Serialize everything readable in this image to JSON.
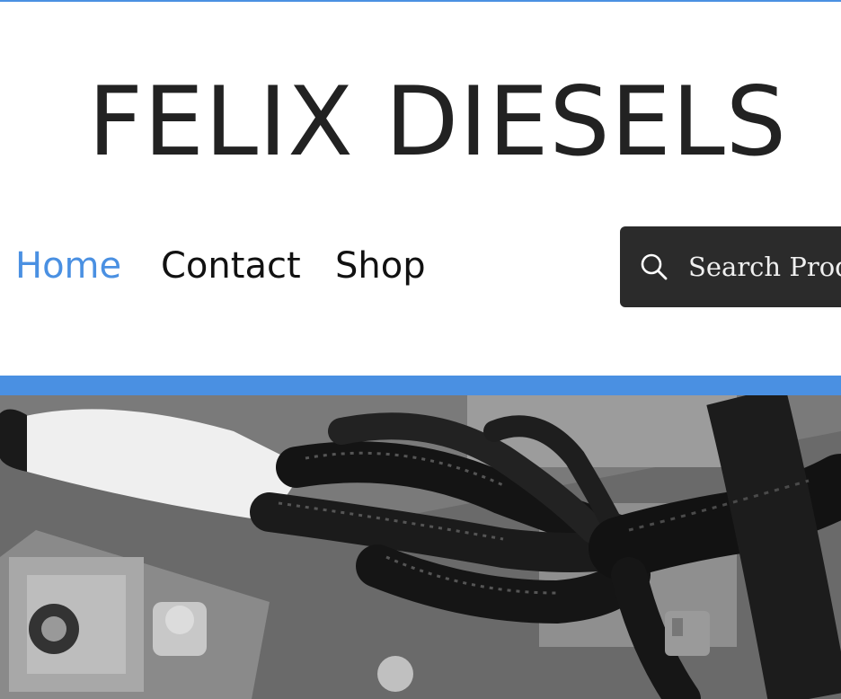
{
  "site": {
    "title": "FELIX DIESELS"
  },
  "nav": {
    "items": [
      {
        "label": "Home",
        "active": true
      },
      {
        "label": "Contact",
        "active": false
      },
      {
        "label": "Shop",
        "active": false
      }
    ]
  },
  "search": {
    "placeholder": "Search Products",
    "icon": "search-icon"
  },
  "hero": {
    "image_subject": "engine wiring harness"
  },
  "colors": {
    "accent": "#4a90e2",
    "title_text": "#222222",
    "search_bg": "#2b2b2b"
  }
}
